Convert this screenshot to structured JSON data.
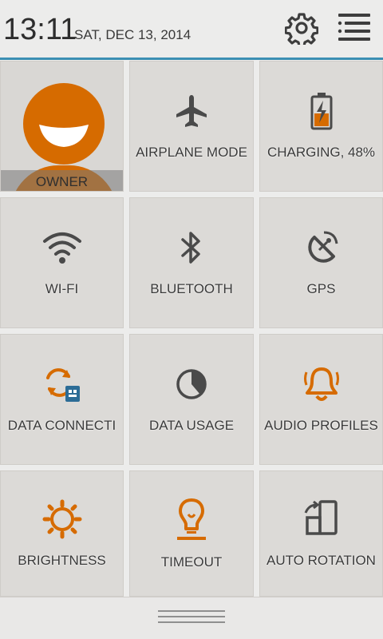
{
  "status": {
    "time": "13:11",
    "date": "SAT, DEC 13, 2014"
  },
  "header": {
    "settings_icon": "gear-icon",
    "list_icon": "list-settings-icon"
  },
  "colors": {
    "accent": "#3b8fb3",
    "active_orange": "#d66b00",
    "icon_gray": "#4a4a4a",
    "tile_bg": "#dcdad7"
  },
  "tiles": {
    "owner": {
      "label": "OWNER",
      "icon": "user-avatar-icon"
    },
    "airplane": {
      "label": "AIRPLANE MODE",
      "icon": "airplane-icon",
      "active": false
    },
    "charging": {
      "label": "CHARGING, 48%",
      "icon": "battery-charging-icon",
      "level_percent": 48
    },
    "wifi": {
      "label": "WI-FI",
      "icon": "wifi-icon",
      "active": false
    },
    "bluetooth": {
      "label": "BLUETOOTH",
      "icon": "bluetooth-icon",
      "active": false
    },
    "gps": {
      "label": "GPS",
      "icon": "gps-satellite-icon",
      "active": false
    },
    "data_connection": {
      "label": "DATA CONNECTI",
      "icon": "data-connection-icon",
      "active": true
    },
    "data_usage": {
      "label": "DATA USAGE",
      "icon": "data-usage-icon",
      "active": false
    },
    "audio_profiles": {
      "label": "AUDIO PROFILES",
      "icon": "bell-icon",
      "active": true
    },
    "brightness": {
      "label": "BRIGHTNESS",
      "icon": "brightness-icon",
      "active": true
    },
    "timeout": {
      "label": "TIMEOUT",
      "icon": "lightbulb-icon",
      "active": true
    },
    "auto_rotation": {
      "label": "AUTO ROTATION",
      "icon": "rotation-icon",
      "active": false
    }
  },
  "bottom": {
    "handle_icon": "drag-handle-icon"
  }
}
